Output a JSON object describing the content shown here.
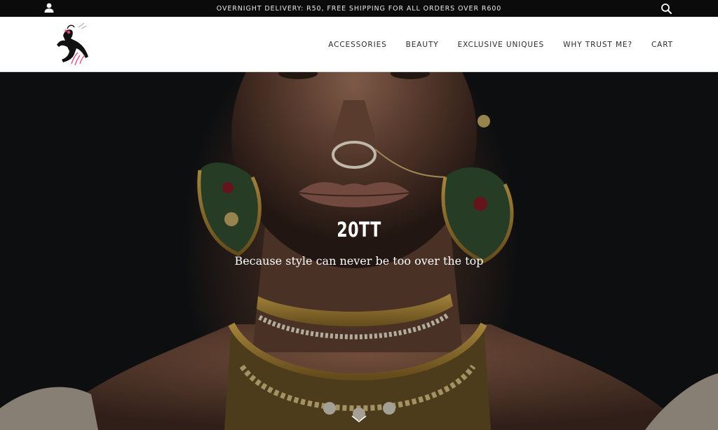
{
  "announcement": {
    "text": "OVERNIGHT DELIVERY: R50, FREE SHIPPING FOR ALL ORDERS OVER R600"
  },
  "icons": {
    "account": "account-icon",
    "search": "search-icon",
    "scroll": "chevron-down-icon"
  },
  "header": {
    "logo_alt": "20TT",
    "nav": [
      {
        "label": "ACCESSORIES"
      },
      {
        "label": "BEAUTY"
      },
      {
        "label": "EXCLUSIVE UNIQUES"
      },
      {
        "label": "WHY TRUST ME?"
      },
      {
        "label": "CART"
      }
    ]
  },
  "hero": {
    "title": "20TT",
    "subtitle": "Because style can never be too over the top"
  },
  "colors": {
    "bar": "#0b0b0b",
    "header_bg": "#ffffff",
    "nav_text": "#2b2b2b",
    "logo_accent": "#e0457b"
  }
}
